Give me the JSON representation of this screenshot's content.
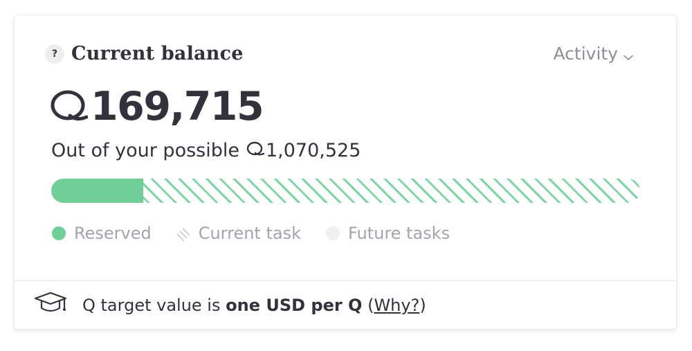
{
  "card": {
    "title": "Current balance",
    "help_icon_label": "?",
    "activity_label": "Activity",
    "balance_value": "169,715",
    "possible_prefix": "Out of your possible",
    "possible_value": "1,070,525",
    "progress": {
      "reserved_fraction": 0.156
    },
    "legend": {
      "reserved": "Reserved",
      "current_task": "Current task",
      "future_tasks": "Future tasks"
    },
    "footer": {
      "text_prefix": "Q target value is",
      "text_bold": "one USD per Q",
      "open_paren": "(",
      "why_link": "Why?",
      "close_paren": ")"
    }
  },
  "colors": {
    "reserved": "#6fcf97",
    "current_task_hatch": "#7fd4a4",
    "future": "#efeff1",
    "text": "#33313b",
    "muted": "#a4a3ab"
  },
  "icons": {
    "help": "question-mark-icon",
    "activity": "chevron-down-icon",
    "currency": "q-currency-icon",
    "footer": "graduation-cap-icon"
  }
}
